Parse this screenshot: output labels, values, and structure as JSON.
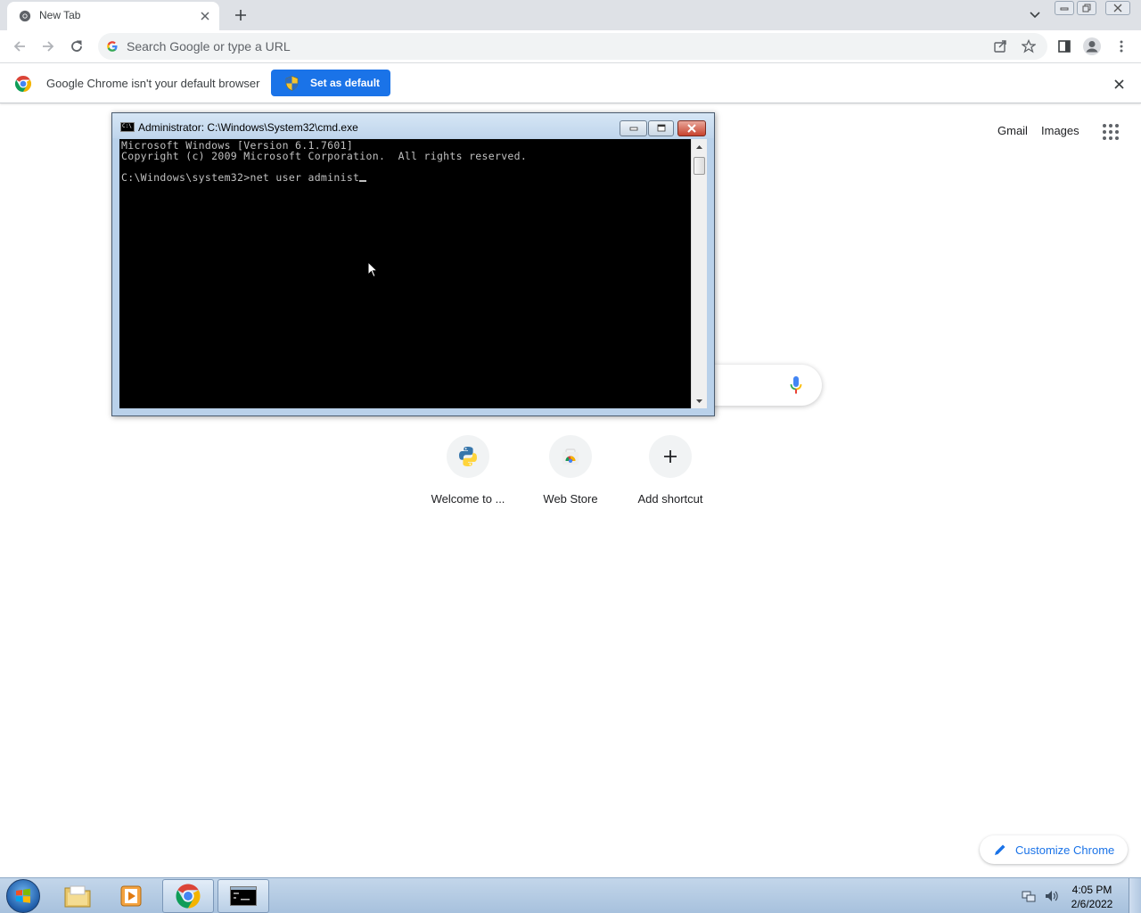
{
  "browser": {
    "tab": {
      "title": "New Tab"
    },
    "omnibox": {
      "placeholder": "Search Google or type a URL"
    },
    "infobar": {
      "message": "Google Chrome isn't your default browser",
      "button_label": "Set as default"
    }
  },
  "ntp": {
    "links": {
      "gmail": "Gmail",
      "images": "Images"
    },
    "shortcuts": [
      {
        "label": "Welcome to ...",
        "icon": "python-icon"
      },
      {
        "label": "Web Store",
        "icon": "web-store-icon"
      },
      {
        "label": "Add shortcut",
        "icon": "plus-icon"
      }
    ],
    "customize_label": "Customize Chrome"
  },
  "cmd": {
    "title": "Administrator: C:\\Windows\\System32\\cmd.exe",
    "lines": [
      "Microsoft Windows [Version 6.1.7601]",
      "Copyright (c) 2009 Microsoft Corporation.  All rights reserved.",
      "",
      "C:\\Windows\\system32>net user administ"
    ]
  },
  "taskbar": {
    "clock_time": "4:05 PM",
    "clock_date": "2/6/2022"
  },
  "colors": {
    "accent": "#1a73e8",
    "tabstrip": "#dee1e6",
    "console_bg": "#000000",
    "console_fg": "#c0c0c0"
  }
}
